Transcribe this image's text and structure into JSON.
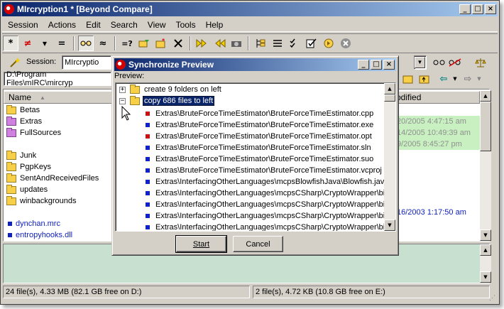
{
  "window": {
    "title": "MIrcryption1 * [Beyond Compare]",
    "min": "_",
    "max": "□",
    "close": "×"
  },
  "menu": [
    "Session",
    "Actions",
    "Edit",
    "Search",
    "View",
    "Tools",
    "Help"
  ],
  "toolbar": {
    "compare_all": "*",
    "diff": "≠",
    "same": "=",
    "approx": "≈",
    "ruler": "=?"
  },
  "session": {
    "label": "Session:",
    "value": "MIrcryptio"
  },
  "left": {
    "path": "D:\\Program Files\\mIRC\\mircryp",
    "column": "Name",
    "folders": [
      {
        "name": "Betas",
        "kind": "normal"
      },
      {
        "name": "Extras",
        "kind": "purple"
      },
      {
        "name": "FullSources",
        "kind": "purple"
      },
      {
        "name": "Junk",
        "kind": "normal"
      },
      {
        "name": "PgpKeys",
        "kind": "normal"
      },
      {
        "name": "SentAndReceivedFiles",
        "kind": "normal"
      },
      {
        "name": "updates",
        "kind": "normal"
      },
      {
        "name": "winbackgrounds",
        "kind": "normal"
      }
    ],
    "files": [
      "dynchan.mrc",
      "entropyhooks.dll"
    ]
  },
  "right": {
    "column": "odified",
    "dates": [
      "20/2005 4:47:15 am",
      "14/2005 10:49:39 am",
      "9/2005 8:45:27 pm"
    ],
    "file_date": "16/2003 1:17:50 am"
  },
  "status": {
    "left": "24 file(s), 4.33 MB  (82.1 GB free on D:)",
    "right": "2 file(s), 4.72 KB  (10.8 GB free on E:)"
  },
  "dialog": {
    "title": "Synchronize Preview",
    "preview_label": "Preview:",
    "group1": "create 9 folders on left",
    "group2": "copy 686 files to left",
    "items": [
      {
        "path": "Extras\\BruteForceTimeEstimator\\BruteForceTimeEstimator.cpp",
        "color": "#d01010"
      },
      {
        "path": "Extras\\BruteForceTimeEstimator\\BruteForceTimeEstimator.exe",
        "color": "#1020d0"
      },
      {
        "path": "Extras\\BruteForceTimeEstimator\\BruteForceTimeEstimator.opt",
        "color": "#d01010"
      },
      {
        "path": "Extras\\BruteForceTimeEstimator\\BruteForceTimeEstimator.sln",
        "color": "#1020d0"
      },
      {
        "path": "Extras\\BruteForceTimeEstimator\\BruteForceTimeEstimator.suo",
        "color": "#1020d0"
      },
      {
        "path": "Extras\\BruteForceTimeEstimator\\BruteForceTimeEstimator.vcproj",
        "color": "#1020d0"
      },
      {
        "path": "Extras\\InterfacingOtherLanguages\\mcpsBlowfishJava\\Blowfish.java",
        "color": "#1020d0"
      },
      {
        "path": "Extras\\InterfacingOtherLanguages\\mcpsCSharp\\CryptoWrapper\\bi",
        "color": "#1020d0"
      },
      {
        "path": "Extras\\InterfacingOtherLanguages\\mcpsCSharp\\CryptoWrapper\\bi",
        "color": "#1020d0"
      },
      {
        "path": "Extras\\InterfacingOtherLanguages\\mcpsCSharp\\CryptoWrapper\\bi",
        "color": "#1020d0"
      },
      {
        "path": "Extras\\InterfacingOtherLanguages\\mcpsCSharp\\CryptoWrapper\\bi",
        "color": "#1020d0"
      }
    ],
    "start_button": "Start",
    "cancel_button": "Cancel"
  }
}
